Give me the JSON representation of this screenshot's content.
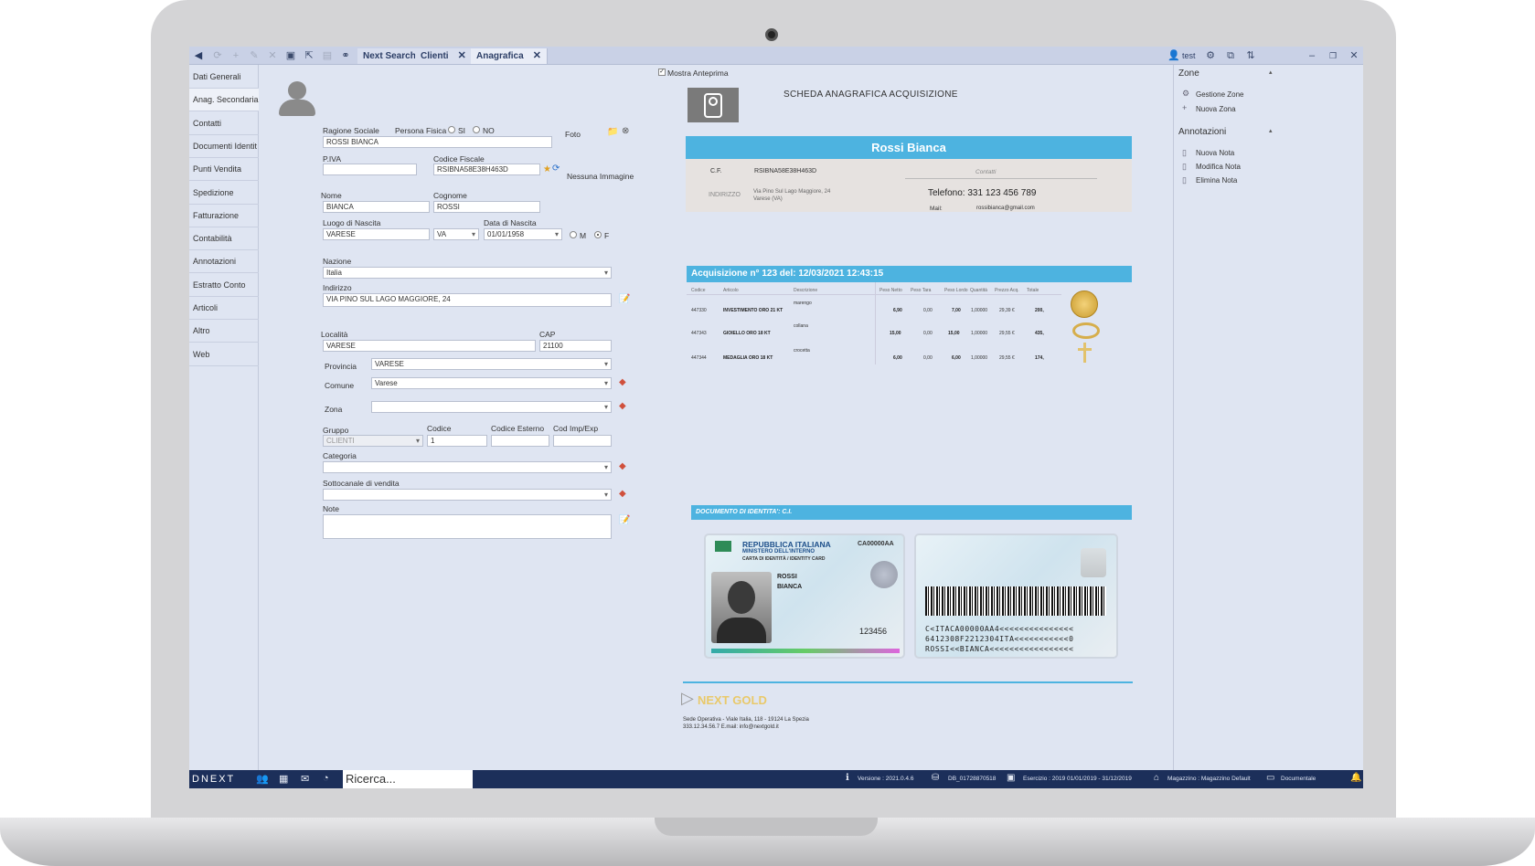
{
  "toolbar": {
    "tabs": [
      {
        "label": "Next Search"
      },
      {
        "label": "Clienti",
        "close": "✕"
      },
      {
        "label": "Anagrafica",
        "close": "✕"
      }
    ],
    "user": "test"
  },
  "leftnav": {
    "items": [
      {
        "label": "Dati Generali"
      },
      {
        "label": "Anag. Secondaria"
      },
      {
        "label": "Contatti"
      },
      {
        "label": "Documenti Identit"
      },
      {
        "label": "Punti Vendita"
      },
      {
        "label": "Spedizione"
      },
      {
        "label": "Fatturazione"
      },
      {
        "label": "Contabilità"
      },
      {
        "label": "Annotazioni"
      },
      {
        "label": "Estratto Conto"
      },
      {
        "label": "Articoli"
      },
      {
        "label": "Altro"
      },
      {
        "label": "Web"
      }
    ]
  },
  "form": {
    "ragione_sociale_label": "Ragione Sociale",
    "persona_fisica_label": "Persona Fisica",
    "si_label": "SI",
    "no_label": "NO",
    "foto_label": "Foto",
    "nessuna_immagine": "Nessuna Immagine",
    "ragione_sociale": "ROSSI BIANCA",
    "piva_label": "P.IVA",
    "piva": "",
    "cf_label": "Codice Fiscale",
    "cf": "RSIBNA58E38H463D",
    "nome_label": "Nome",
    "nome": "BIANCA",
    "cognome_label": "Cognome",
    "cognome": "ROSSI",
    "luogo_label": "Luogo di Nascita",
    "luogo": "VARESE",
    "prov_nascita": "VA",
    "data_label": "Data di Nascita",
    "data": "01/01/1958",
    "m_label": "M",
    "f_label": "F",
    "nazione_label": "Nazione",
    "nazione": "Italia",
    "indirizzo_label": "Indirizzo",
    "indirizzo": "VIA PINO SUL LAGO MAGGIORE, 24",
    "localita_label": "Località",
    "localita": "VARESE",
    "cap_label": "CAP",
    "cap": "21100",
    "provincia_label": "Provincia",
    "provincia": "VARESE",
    "comune_label": "Comune",
    "comune": "Varese",
    "zona_label": "Zona",
    "zona": "",
    "gruppo_label": "Gruppo",
    "gruppo": "CLIENTI",
    "codice_label": "Codice",
    "codice": "1",
    "codice_esterno_label": "Codice Esterno",
    "cod_imp_label": "Cod Imp/Exp",
    "categoria_label": "Categoria",
    "sottocanale_label": "Sottocanale di vendita",
    "note_label": "Note"
  },
  "preview": {
    "mostra_anteprima": "Mostra Anteprima",
    "scheda_title": "SCHEDA ANAGRAFICA ACQUISIZIONE",
    "name_banner": "Rossi Bianca",
    "cf_label": "C.F.",
    "cf_value": "RSIBNA58E38H463D",
    "contatti_label": "Contatti",
    "indirizzo_label": "INDIRIZZO",
    "indirizzo_line1": "Via Pino Sul Lago Maggiore, 24",
    "indirizzo_line2": "Varese (VA)",
    "telefono": "Telefono: 331 123 456 789",
    "mail_label": "Mail:",
    "mail": "rossibianca@gmail.com",
    "acquisizione_title": "Acquisizione n° 123 del:  12/03/2021 12:43:15",
    "table_headers": [
      "Codice",
      "Articolo",
      "Descrizione",
      "Peso Netto",
      "Peso Tara",
      "Peso Lordo",
      "Quantità",
      "Prezzo Acq.",
      "Totale"
    ],
    "rows": [
      {
        "codice": "447330",
        "articolo": "INVESTIMENTO ORO 21 KT",
        "descrizione": "marengo",
        "peso_netto": "6,90",
        "peso_tara": "0,00",
        "peso_lordo": "7,00",
        "quantita": "1,00000",
        "prezzo": "29,39 €",
        "totale": "200,"
      },
      {
        "codice": "447343",
        "articolo": "GIOIELLO ORO 18 KT",
        "descrizione": "collana",
        "peso_netto": "15,00",
        "peso_tara": "0,00",
        "peso_lordo": "15,00",
        "quantita": "1,00000",
        "prezzo": "29,55 €",
        "totale": "435,"
      },
      {
        "codice": "447344",
        "articolo": "MEDAGLIA ORO 18 KT",
        "descrizione": "crocetta",
        "peso_netto": "6,00",
        "peso_tara": "0,00",
        "peso_lordo": "6,00",
        "quantita": "1,00000",
        "prezzo": "29,55 €",
        "totale": "174,"
      }
    ],
    "documento_title": "DOCUMENTO DI IDENTITA': C.I.",
    "card_front": {
      "repubblica": "REPUBBLICA ITALIANA",
      "ministero": "MINISTERO DELL'INTERNO",
      "carta": "CARTA DI IDENTITÀ / IDENTITY CARD",
      "numero": "CA00000AA",
      "cognome": "ROSSI",
      "nome": "BIANCA",
      "code": "123456"
    },
    "card_back": {
      "mrz1": "C<ITACA00000AA4<<<<<<<<<<<<<<<",
      "mrz2": "6412308F2212304ITA<<<<<<<<<<<0",
      "mrz3": "ROSSI<<BIANCA<<<<<<<<<<<<<<<<<"
    },
    "logo_text": "NEXT GOLD",
    "footer_line1": "Sede Operativa - Viale Italia, 118 - 19124  La Spezia",
    "footer_line2": "333.12.34.56.7  E.mail: info@nextgold.it"
  },
  "rightpanel": {
    "zone_title": "Zone",
    "zone_items": [
      {
        "label": "Gestione Zone"
      },
      {
        "label": "Nuova Zona"
      }
    ],
    "annotazioni_title": "Annotazioni",
    "annotazioni_items": [
      {
        "label": "Nuova Nota"
      },
      {
        "label": "Modifica Nota"
      },
      {
        "label": "Elimina Nota"
      }
    ]
  },
  "statusbar": {
    "brand": "DNEXT",
    "search_placeholder": "Ricerca...",
    "versione": "Versione : 2021.0.4.6",
    "db": "DB_01728870518",
    "esercizio": "Esercizio : 2019 01/01/2019 - 31/12/2019",
    "magazzino": "Magazzino : Magazzino Default",
    "documentale": "Documentale"
  },
  "colors": {
    "accent": "#4db3e0",
    "statusbar": "#1c2f5a",
    "toolbar": "#c9d1e6"
  }
}
